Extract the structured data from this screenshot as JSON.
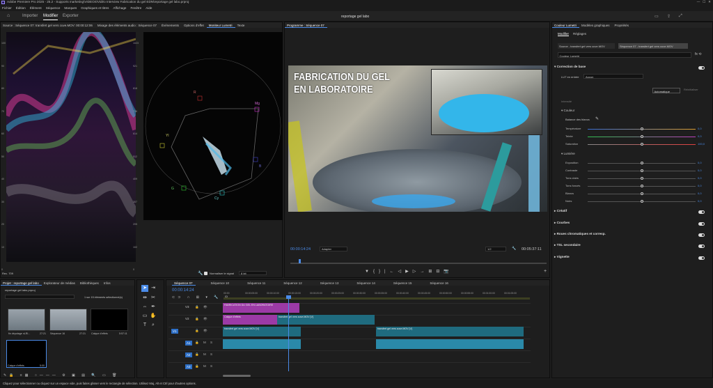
{
  "window": {
    "title": "Adobe Premiere Pro 2025 - 25.2 - Supports marketing\\VIDEOS\\Vidéo Interview Fabrication du gel EDN\\reportage gel labo.prproj"
  },
  "menu": [
    "Fichier",
    "Édition",
    "Élément",
    "Séquence",
    "Marques",
    "Graphiques et titres",
    "Affichage",
    "Fenêtre",
    "Aide"
  ],
  "modes": {
    "home": "home-icon",
    "importer": "Importer",
    "modifier": "Modifier",
    "exporter": "Exporter",
    "project_title": "reportage gel labo"
  },
  "source_panel": {
    "tabs": [
      "Source : Séquence 07: transfert gel vers cuve.MOV: 00:00:12:06",
      "Mixage des éléments audio : Séquence 07",
      "Événements",
      "Options d'effet",
      "Moniteur Lumetri",
      "Texte"
    ],
    "wave_scale_left": [
      "100",
      "90",
      "80",
      "70",
      "60",
      "50",
      "40",
      "30",
      "20",
      "10",
      "0"
    ],
    "wave_scale_right": [
      "1023",
      "921",
      "818",
      "716",
      "614",
      "512",
      "409",
      "307",
      "205",
      "102",
      "0"
    ],
    "vector_labels": {
      "R": "R",
      "Mg": "Mg",
      "B": "B",
      "Cy": "Cy",
      "G": "G",
      "Yl": "Yl"
    },
    "bottom_label": "8 bit",
    "norm_label": "Normaliser le signal",
    "rec_label": "Rec. 709"
  },
  "program": {
    "tab": "Programme : Séquence 07",
    "overlay_line1": "FABRICATION DU GEL",
    "overlay_line2": "EN LABORATOIRE",
    "timecode": "00:00:14:24",
    "fit": "Adapter",
    "quality": "1/2",
    "duration": "00:05:37:11"
  },
  "lumetri": {
    "tabs": [
      "Couleur Lumetri",
      "Modèles graphiques",
      "Propriétés"
    ],
    "subtabs": [
      "Modifier",
      "Réglages"
    ],
    "source_btn": "Source - transfert gel vers cuve.MOV",
    "seq_btn": "Séquence 07 - transfert gel vers cuve.MOV",
    "effect_select": "Couleur Lumetri",
    "basic": "Correction de base",
    "lut_label": "LUT en entrée",
    "lut_value": "Aucun",
    "auto_btn": "Automatique",
    "reset_btn": "Réinitialiser",
    "intensity_label": "Intensité",
    "color_label": "Couleur",
    "wb_label": "Balance des blancs",
    "color_rows": [
      {
        "label": "Température",
        "value": "0,0"
      },
      {
        "label": "Teinte",
        "value": "0,0"
      },
      {
        "label": "Saturation",
        "value": "100,0"
      }
    ],
    "light_label": "Lumière",
    "light_rows": [
      {
        "label": "Exposition",
        "value": "0,0"
      },
      {
        "label": "Contraste",
        "value": "0,0"
      },
      {
        "label": "Tons clairs",
        "value": "0,0"
      },
      {
        "label": "Tons foncés",
        "value": "0,0"
      },
      {
        "label": "Blancs",
        "value": "0,0"
      },
      {
        "label": "Noirs",
        "value": "0,0"
      }
    ],
    "sections": [
      "Créatif",
      "Courbes",
      "Roues chromatiques et corresp.",
      "TSL secondaire",
      "Vignette"
    ]
  },
  "project": {
    "tabs": [
      "Projet : reportage gel labo",
      "Explorateur de médias",
      "Bibliothèques",
      "Infos"
    ],
    "file": "reportage gel labo.prproj",
    "count": "1 sur 15 éléments sélectionné(s)",
    "items": [
      {
        "name": "fin dépotage nLRI...",
        "dur": "27:21"
      },
      {
        "name": "Séquence 16",
        "dur": "27:21"
      },
      {
        "name": "Calque d'effets",
        "dur": "5:57:11"
      },
      {
        "name": "Calque d'effets",
        "dur": "5:00"
      }
    ]
  },
  "timeline": {
    "tabs": [
      "Séquence 07",
      "Séquence 10",
      "Séquence 11",
      "Séquence 12",
      "Séquence 13",
      "Séquence 14",
      "Séquence 15",
      "Séquence 16"
    ],
    "timecode": "00:00:14:24",
    "ruler": [
      "00:00",
      "00:00:05:00",
      "00:00:10:00",
      "00:00:15:00",
      "00:00:20:00",
      "00:00:25:00",
      "00:00:30:00",
      "00:00:35:00",
      "00:00:40:00",
      "00:00:45:00",
      "00:00:50:00",
      "00:00:55:00",
      "00:01:00:00",
      "00:01:05:00"
    ],
    "tracks": [
      "V3",
      "V2",
      "V1",
      "A1",
      "A2",
      "A3"
    ],
    "clip_title": "FABRICATION DU GEL EN LABORATOIRE",
    "clip_effect": "Calque d'effets",
    "clip_v2": "transfert gel vers cuve.MOV [V]",
    "clip_v1a": "transfert gel vers cuve.MOV [V]",
    "clip_v1b": "transfert gel vers cuve.MOV [V]"
  },
  "status": "Cliquez pour sélectionner ou cliquez sur un espace vide, puis faites glisser vers le rectangle de sélection. Utilisez Maj, Alt et Ctrl pour d'autres options.",
  "colors": {
    "accent": "#4a8be8",
    "title_clip": "#9c3aa6",
    "video_clip": "#1f6b7f",
    "audio_clip": "#2d9cc2"
  }
}
